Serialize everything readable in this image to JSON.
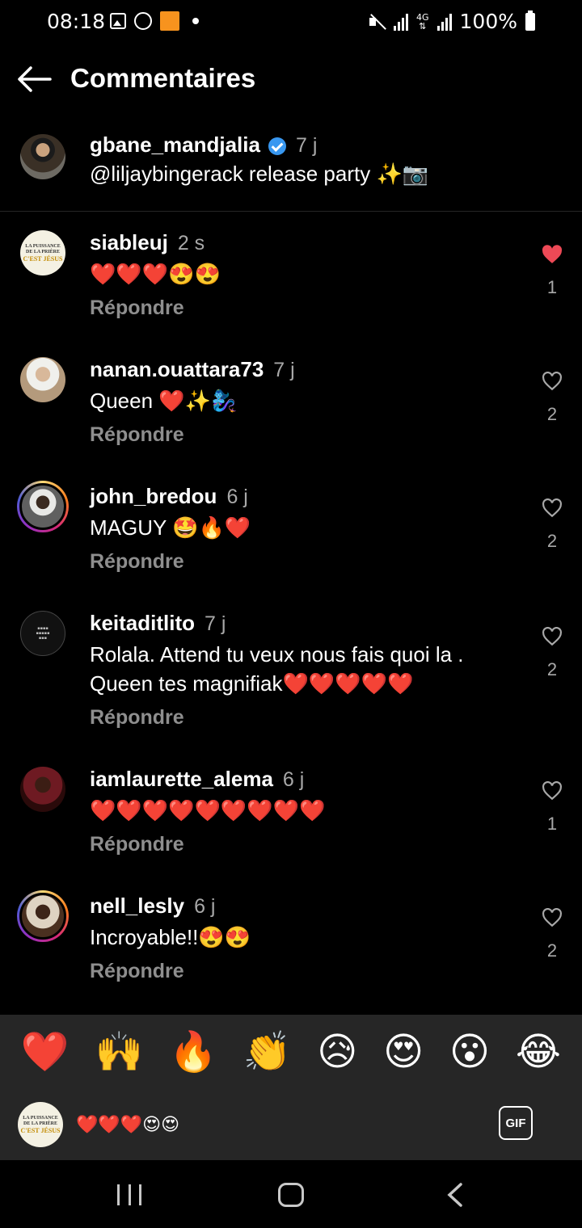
{
  "status_bar": {
    "time": "08:18",
    "battery": "100%",
    "network": "4G"
  },
  "header": {
    "title": "Commentaires"
  },
  "caption": {
    "username": "gbane_mandjalia",
    "verified": true,
    "time": "7 j",
    "text": "@liljaybingerack release party ✨📷"
  },
  "comments": [
    {
      "username": "siableuj",
      "time": "2 s",
      "text": "❤️❤️❤️😍😍",
      "reply": "Répondre",
      "likes": "1",
      "liked": true,
      "avatar": "cest-jesus-logo"
    },
    {
      "username": "nanan.ouattara73",
      "time": "7 j",
      "text": "Queen ❤️✨🧞‍♀️",
      "reply": "Répondre",
      "likes": "2",
      "liked": false,
      "avatar": "photo"
    },
    {
      "username": "john_bredou",
      "time": "6 j",
      "text": "MAGUY 🤩🔥❤️",
      "reply": "Répondre",
      "likes": "2",
      "liked": false,
      "avatar": "photo-story-ring"
    },
    {
      "username": "keitaditlito",
      "time": "7 j",
      "text": "Rolala. Attend tu veux nous fais quoi la .\nQueen tes magnifiak❤️❤️❤️❤️❤️",
      "reply": "Répondre",
      "likes": "2",
      "liked": false,
      "avatar": "text-logo"
    },
    {
      "username": "iamlaurette_alema",
      "time": "6 j",
      "text": "❤️❤️❤️❤️❤️❤️❤️❤️❤️",
      "reply": "Répondre",
      "likes": "1",
      "liked": false,
      "avatar": "photo"
    },
    {
      "username": "nell_lesly",
      "time": "6 j",
      "text": "Incroyable!!😍😍",
      "reply": "Répondre",
      "likes": "2",
      "liked": false,
      "avatar": "photo-story-ring"
    }
  ],
  "quick_emojis": [
    "❤️",
    "🙌",
    "🔥",
    "👏",
    "😥",
    "😍",
    "😮",
    "😂"
  ],
  "composer": {
    "value": "❤️❤️❤️😍😍",
    "gif_label": "GIF"
  },
  "colors": {
    "background": "#000000",
    "panel": "#262626",
    "liked_heart": "#ed4956",
    "muted_text": "#8e8e8e",
    "verified": "#3897f0"
  }
}
